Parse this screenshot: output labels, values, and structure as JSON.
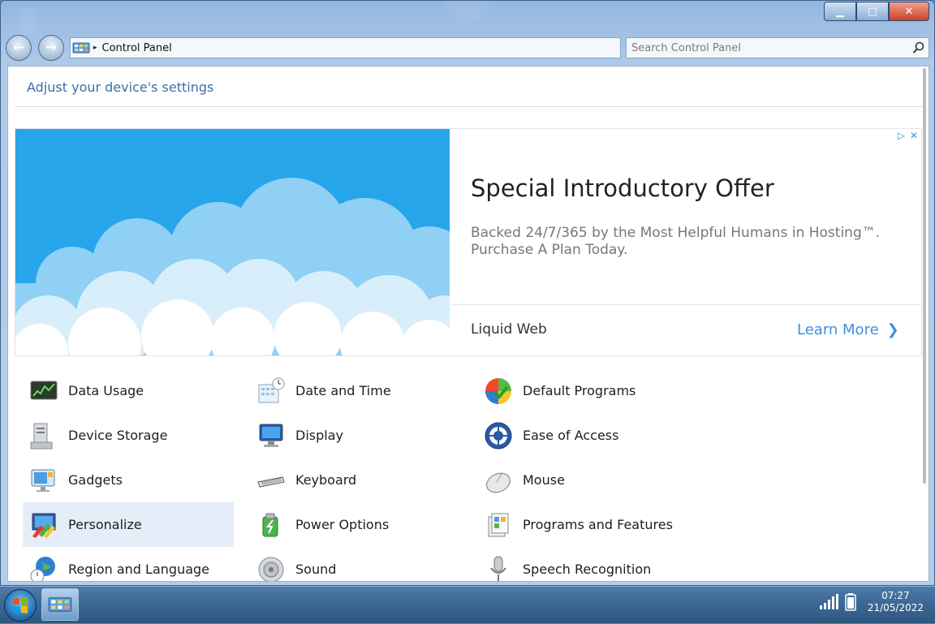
{
  "window": {
    "title_buttons": {
      "minimize": "▁",
      "maximize": "▢",
      "close": "✕"
    }
  },
  "desktop": {
    "scroll_hint": "⌄"
  },
  "toolbar": {
    "back_glyph": "←",
    "forward_glyph": "→",
    "breadcrumb": "Control Panel",
    "breadcrumb_separator": "▸",
    "search_placeholder": "Search Control Panel"
  },
  "header": {
    "title": "Adjust your device's settings"
  },
  "ad": {
    "title": "Special Introductory Offer",
    "body": "Backed 24/7/365 by the Most Helpful Humans in Hosting™. Purchase A Plan Today.",
    "brand": "Liquid Web",
    "cta": "Learn More",
    "cta_chevron": "❯",
    "choice_icons": [
      "▷",
      "✕"
    ]
  },
  "items": [
    {
      "label": "Data Usage",
      "icon": "data-usage-icon"
    },
    {
      "label": "Date and Time",
      "icon": "date-time-icon"
    },
    {
      "label": "Default Programs",
      "icon": "default-programs-icon"
    },
    {
      "label": "Device Storage",
      "icon": "device-storage-icon"
    },
    {
      "label": "Display",
      "icon": "display-icon"
    },
    {
      "label": "Ease of Access",
      "icon": "ease-of-access-icon"
    },
    {
      "label": "Gadgets",
      "icon": "gadgets-icon"
    },
    {
      "label": "Keyboard",
      "icon": "keyboard-icon"
    },
    {
      "label": "Mouse",
      "icon": "mouse-icon"
    },
    {
      "label": "Personalize",
      "icon": "personalize-icon",
      "selected": true
    },
    {
      "label": "Power Options",
      "icon": "power-options-icon"
    },
    {
      "label": "Programs and Features",
      "icon": "programs-features-icon"
    },
    {
      "label": "Region and Language",
      "icon": "region-language-icon"
    },
    {
      "label": "Sound",
      "icon": "sound-icon"
    },
    {
      "label": "Speech Recognition",
      "icon": "speech-recognition-icon"
    }
  ],
  "taskbar": {
    "time": "07:27",
    "date": "21/05/2022"
  },
  "colors": {
    "heading": "#3d6fa8",
    "ad_image_blue": "#27a5ea",
    "cta_blue": "#3f8fde",
    "selected_bg": "#e5eef8"
  }
}
